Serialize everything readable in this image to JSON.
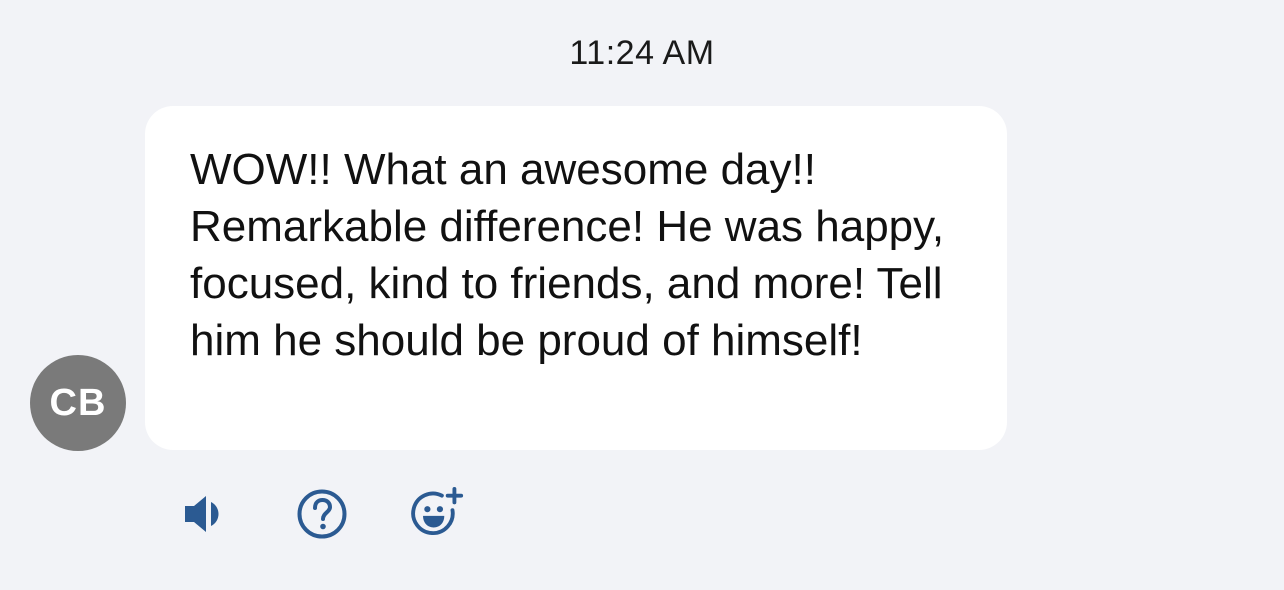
{
  "message": {
    "timestamp": "11:24 AM",
    "sender_initials": "CB",
    "text": "WOW!! What an awesome day!! Remarkable difference! He was happy, focused, kind to friends, and more! Tell him he should be proud of himself!"
  },
  "actions": [
    {
      "icon": "speaker-icon"
    },
    {
      "icon": "question-icon"
    },
    {
      "icon": "add-reaction-icon"
    }
  ],
  "colors": {
    "background": "#f2f3f7",
    "bubble": "#ffffff",
    "avatar": "#7a7a7a",
    "icon": "#2b5a92"
  }
}
